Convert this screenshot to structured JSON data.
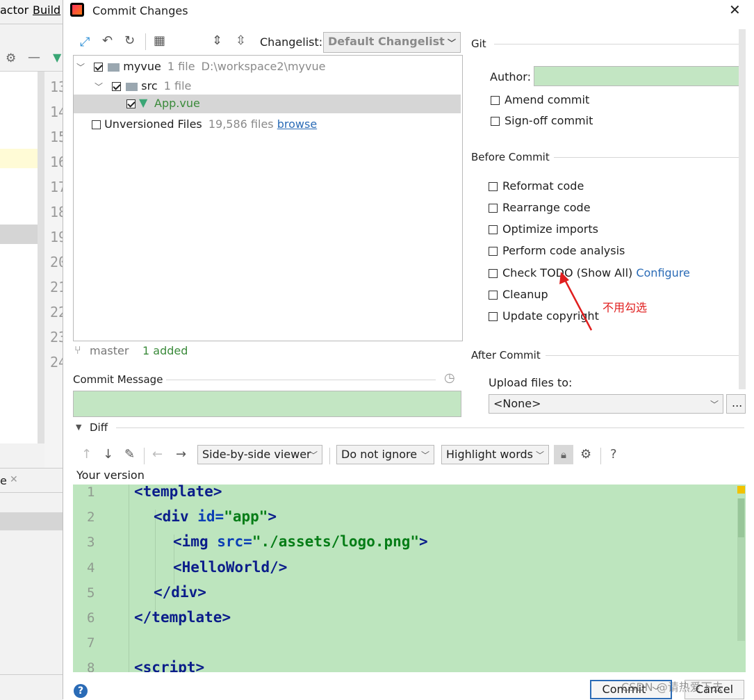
{
  "ide": {
    "menu": [
      "actor",
      "Build"
    ],
    "line_numbers": [
      "13",
      "14",
      "15",
      "16",
      "17",
      "18",
      "19",
      "20",
      "21",
      "22",
      "23",
      "24"
    ],
    "tab_stub": "e"
  },
  "dialog": {
    "title": "Commit Changes",
    "changelist_label": "Changelist:",
    "changelist_value": "Default Changelist",
    "tree": {
      "root_name": "myvue",
      "root_count": "1 file",
      "root_path": "D:\\workspace2\\myvue",
      "src_name": "src",
      "src_count": "1 file",
      "file_name": "App.vue",
      "unversioned_label": "Unversioned Files",
      "unversioned_count": "19,586 files",
      "browse_link": "browse"
    },
    "branch": "master",
    "status": "1 added",
    "commit_message_label": "Commit Message",
    "git": {
      "section": "Git",
      "author_label": "Author:",
      "author_value": "",
      "amend": "Amend commit",
      "signoff": "Sign-off commit"
    },
    "before_commit": {
      "section": "Before Commit",
      "reformat": "Reformat code",
      "rearrange": "Rearrange code",
      "optimize": "Optimize imports",
      "analysis": "Perform code analysis",
      "todo": "Check TODO (Show All)",
      "todo_link": "Configure",
      "cleanup": "Cleanup",
      "copyright": "Update copyright"
    },
    "annotation": "不用勾选",
    "after_commit": {
      "section": "After Commit",
      "upload_label": "Upload files to:",
      "upload_value": "<None>",
      "more_button": "..."
    },
    "diff": {
      "section": "Diff",
      "viewer": "Side-by-side viewer",
      "ignore": "Do not ignore",
      "highlight": "Highlight words",
      "help": "?",
      "your_version": "Your version",
      "line_numbers": [
        "1",
        "2",
        "3",
        "4",
        "5",
        "6",
        "7",
        "8"
      ],
      "code": {
        "l1_tag": "template",
        "l2_tag": "div",
        "l2_attr": "id=",
        "l2_val": "\"app\"",
        "l3_tag": "img",
        "l3_attr": "src=",
        "l3_val": "\"./assets/logo.png\"",
        "l4_tag": "HelloWorld",
        "l5_tag": "div",
        "l6_tag": "template",
        "l8_tag": "script"
      }
    },
    "buttons": {
      "help": "?",
      "commit": "Commit",
      "cancel": "Cancel"
    },
    "watermark": "CSDN @请热爱下去"
  },
  "colors": {
    "accent_green": "#c3e6c3",
    "diff_green": "#bde5be",
    "link": "#2a6bb6",
    "annotation": "#e01e1e"
  }
}
